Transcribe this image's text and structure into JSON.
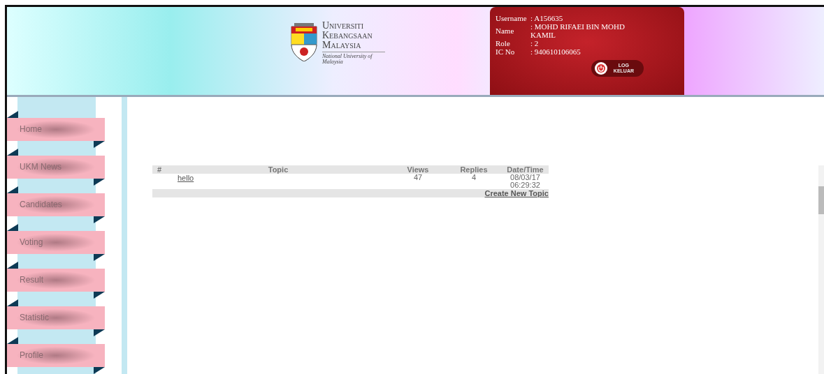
{
  "header": {
    "logo": {
      "line_1": "Universiti",
      "line_2": "Kebangsaan",
      "line_3": "Malaysia",
      "tagline": "National University of Malaysia"
    },
    "profile": {
      "fields": [
        {
          "label": "Username",
          "value": ": A156635"
        },
        {
          "label": "Name",
          "value": ": MOHD RIFAEI BIN MOHD KAMIL"
        },
        {
          "label": "Role",
          "value": ": 2"
        },
        {
          "label": "IC No",
          "value": ": 940610106065"
        }
      ],
      "logout": {
        "line_1": "LOG",
        "line_2": "KELUAR"
      }
    }
  },
  "sidebar": {
    "items": [
      {
        "label": "Home"
      },
      {
        "label": "UKM News"
      },
      {
        "label": "Candidates"
      },
      {
        "label": "Voting"
      },
      {
        "label": "Result"
      },
      {
        "label": "Statistic"
      },
      {
        "label": "Profile"
      }
    ]
  },
  "forum": {
    "columns": [
      "#",
      "Topic",
      "Views",
      "Replies",
      "Date/Time"
    ],
    "rows": [
      {
        "topic": "hello",
        "views": "47",
        "replies": "4",
        "datetime": "08/03/17 06:29:32"
      }
    ],
    "create_link": "Create New Topic"
  }
}
